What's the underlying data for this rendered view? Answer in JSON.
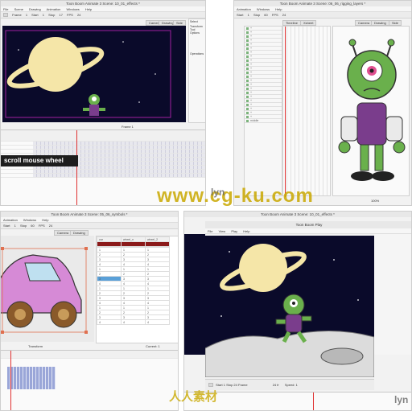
{
  "q1": {
    "window_title": "Toon Boom Animate 3 Scene: 10_01_effects *",
    "menu": [
      "File",
      "Scene",
      "Drawing",
      "Animation",
      "Windows",
      "Help"
    ],
    "toolbar": [
      "Frame",
      "1",
      "Start",
      "1",
      "Stop",
      "17",
      "FPS",
      "24"
    ],
    "tabs": [
      "Camera",
      "Drawing",
      "Side"
    ],
    "right_tabs": [
      "Select",
      "Tool Prope"
    ],
    "panel_heading": "Transform Tool Options",
    "operations": "Operations",
    "overlay_label": "scroll mouse wheel",
    "bottom_readout": "Frame 1"
  },
  "q2": {
    "window_title": "Toon Boom Animate 3 Scene: 06_06_rigging_layers *",
    "menu": [
      "Animation",
      "Windows",
      "Help"
    ],
    "toolbar": [
      "Start",
      "1",
      "Stop",
      "60",
      "FPS",
      "24"
    ],
    "tabs": [
      "Timeline",
      "Xsheet",
      "Camera",
      "Drawing",
      "Side"
    ],
    "layer_special": "middle",
    "bottom_readout": "100%"
  },
  "q3": {
    "window_title": "Toon Boom Animate 3 Scene: 05_06_symbols *",
    "menu": [
      "Animation",
      "Windows",
      "Help"
    ],
    "toolbar": [
      "Start",
      "1",
      "Stop",
      "60",
      "FPS",
      "24"
    ],
    "tabs": [
      "Camera",
      "Drawing"
    ],
    "xsheet_headers": [
      "car",
      "wheel_n",
      "wheel_2"
    ],
    "xsheet_rows": [
      [
        "1",
        "1",
        "1"
      ],
      [
        "2",
        "2",
        "2"
      ],
      [
        "3",
        "3",
        "3"
      ],
      [
        "4",
        "4",
        "4"
      ],
      [
        "1",
        "1",
        "1"
      ],
      [
        "2",
        "2",
        "2"
      ],
      [
        "3",
        "3",
        "3"
      ],
      [
        "4",
        "4",
        "4"
      ],
      [
        "1",
        "1",
        "1"
      ],
      [
        "2",
        "2",
        "2"
      ],
      [
        "3",
        "3",
        "3"
      ],
      [
        "4",
        "4",
        "4"
      ],
      [
        "1",
        "1",
        "1"
      ],
      [
        "2",
        "2",
        "2"
      ],
      [
        "3",
        "3",
        "3"
      ],
      [
        "4",
        "4",
        "4"
      ]
    ],
    "bottom_left": "Transform",
    "bottom_right": "Current: 1"
  },
  "q4": {
    "window_title": "Toon Boom Animate 3 Scene: 10_01_effects *",
    "player_title": "Toon Boom Play",
    "menu": [
      "File",
      "View",
      "Play",
      "Help"
    ],
    "player_controls": [
      "Start",
      "1",
      "Stop",
      "24",
      "Frame"
    ],
    "speed": "Speed: 1",
    "frame_readout": "24 fr"
  },
  "watermark": "www.cg-ku.com",
  "watermark2": "人人素材",
  "brand": "lyn",
  "colors": {
    "sky": "#0a0a2a",
    "planet": "#f5e6a8",
    "alien_green": "#6ab04c",
    "alien_purple": "#7a3d8c",
    "car": "#d68ad6",
    "wheel": "#8a5a2a",
    "playhead": "#e03030"
  }
}
